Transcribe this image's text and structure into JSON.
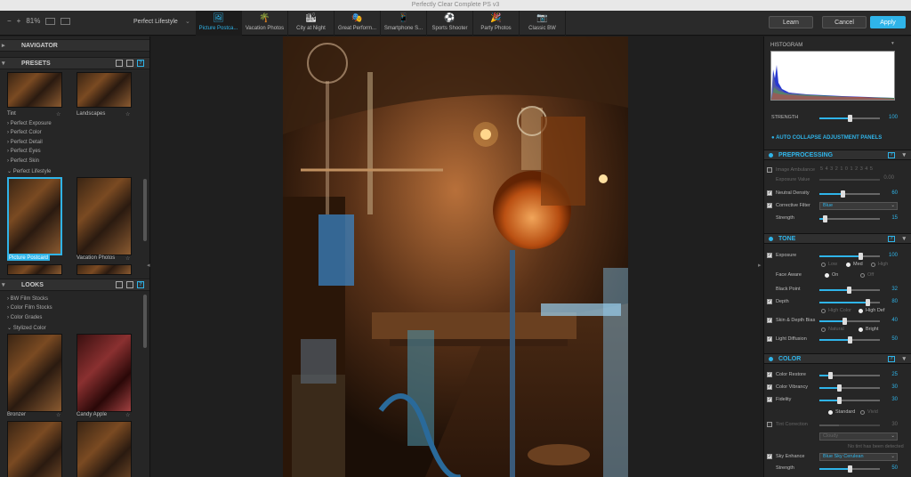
{
  "window": {
    "title": "Perfectly Clear Complete PS v3"
  },
  "toolbar": {
    "zoom_out": "−",
    "zoom_in": "+",
    "zoom": "81%",
    "preset_name": "Perfect Lifestyle",
    "categories": [
      {
        "label": "Picture Postca...",
        "icon": "postcard-icon",
        "glyph": "🖼"
      },
      {
        "label": "Vacation Photos",
        "icon": "palm-tree-icon",
        "glyph": "🌴"
      },
      {
        "label": "City at Night",
        "icon": "city-icon",
        "glyph": "🏙"
      },
      {
        "label": "Great Perform...",
        "icon": "stage-icon",
        "glyph": "🎭"
      },
      {
        "label": "Smartphone S...",
        "icon": "smartphone-icon",
        "glyph": "📱"
      },
      {
        "label": "Sports Shooter",
        "icon": "soccer-ball-icon",
        "glyph": "⚽"
      },
      {
        "label": "Party Photos",
        "icon": "party-icon",
        "glyph": "🎉"
      },
      {
        "label": "Classic BW",
        "icon": "camera-icon",
        "glyph": "📷"
      }
    ],
    "learn": "Learn",
    "cancel": "Cancel",
    "apply": "Apply"
  },
  "left": {
    "navigator": "NAVIGATOR",
    "presets": "PRESETS",
    "presets_thumbs_top": [
      "Tint",
      "Landscapes"
    ],
    "preset_groups": [
      "Perfect Exposure",
      "Perfect Color",
      "Perfect Detail",
      "Perfect Eyes",
      "Perfect Skin",
      "Perfect Lifestyle"
    ],
    "preset_thumbs": [
      "Picture Postcard",
      "Vacation Photos"
    ],
    "looks": "LOOKS",
    "look_groups": [
      "BW Film Stocks",
      "Color Film Stocks",
      "Color Grades",
      "Stylized Color"
    ],
    "look_thumbs": [
      "Bronzer",
      "Candy Apple"
    ],
    "help": "?"
  },
  "right": {
    "histogram": "HISTOGRAM",
    "strength_label": "STRENGTH",
    "strength_value": "100",
    "strength_fraction": 1.0,
    "auto_collapse": "AUTO COLLAPSE ADJUSTMENT PANELS",
    "help": "?",
    "preprocessing": {
      "title": "PREPROCESSING",
      "image_ambulance": "Image Ambulance",
      "scale": "5 4 3 2 1 0 1 2 3 4 5",
      "exposure_value": "Exposure Value",
      "exposure_value_num": "0.00",
      "neutral_density": "Neutral Density",
      "neutral_density_value": "60",
      "corrective_filter": "Corrective Filter",
      "corrective_filter_value": "Blue",
      "strength": "Strength",
      "strength_value": "15"
    },
    "tone": {
      "title": "TONE",
      "exposure": "Exposure",
      "exposure_value": "100",
      "face_aware": "Face Aware",
      "low": "Low",
      "med": "Med",
      "high": "High",
      "on": "On",
      "off": "Off",
      "black_point": "Black Point",
      "black_point_value": "32",
      "depth": "Depth",
      "depth_value": "80",
      "high_color": "High Color",
      "high_def": "High Def",
      "skin_depth_bias": "Skin & Depth Bias",
      "skin_depth_bias_value": "40",
      "natural": "Natural",
      "bright": "Bright",
      "light_diffusion": "Light Diffusion",
      "light_diffusion_value": "50"
    },
    "color": {
      "title": "COLOR",
      "color_restore": "Color Restore",
      "color_restore_value": "25",
      "color_vibrancy": "Color Vibrancy",
      "color_vibrancy_value": "30",
      "fidelity": "Fidelity",
      "fidelity_value": "30",
      "standard": "Standard",
      "vivid": "Vivid",
      "tint_correction": "Tint Correction",
      "tint_correction_value": "30",
      "tint_dropdown": "Cloudy",
      "no_tint": "No tint has been detected",
      "sky_enhance": "Sky Enhance",
      "sky_enhance_value": "Blue Sky Cerulean",
      "strength": "Strength",
      "strength_value": "50"
    }
  }
}
